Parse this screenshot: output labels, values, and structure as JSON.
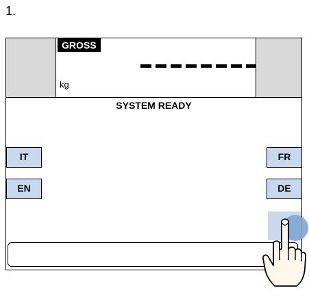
{
  "step_label": "1.",
  "display": {
    "mode_label": "GROSS",
    "unit": "kg",
    "reading": "--------"
  },
  "status_text": "SYSTEM READY",
  "languages": {
    "it": "IT",
    "en": "EN",
    "fr": "FR",
    "de": "DE"
  },
  "icons": {
    "hand": "pointing-hand-icon"
  },
  "colors": {
    "button_fill": "#c8d9ee",
    "corner_fill": "#d9d9d9",
    "press_indicator": "#7ea6d4"
  }
}
